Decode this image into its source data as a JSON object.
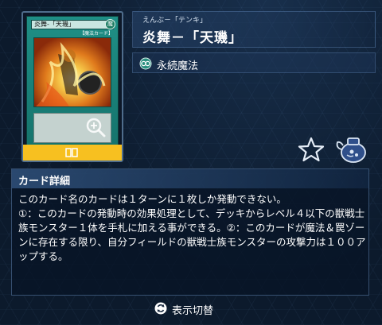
{
  "card": {
    "image_name": "炎舞-「天璣」",
    "image_type_line": "【魔法カード】",
    "attribute_glyph": "魔",
    "zoom_icon": "magnify-plus-icon",
    "tab_icon": "cards-icon"
  },
  "header": {
    "ruby": "えんぶ－「テンキ」",
    "name": "炎舞－「天璣」"
  },
  "type": {
    "icon": "continuous-spell-icon",
    "label": "永続魔法"
  },
  "actions": {
    "favorite_icon": "star-icon",
    "deck_icon": "deck-pot-icon"
  },
  "detail": {
    "title": "カード詳細",
    "text": "このカード名のカードは１ターンに１枚しか発動できない。\n①：このカードの発動時の効果処理として、デッキからレベル４以下の獣戦士族モンスター１体を手札に加える事ができる。②：このカードが魔法＆罠ゾーンに存在する限り、自分フィールドの獣戦士族モンスターの攻撃力は１００アップする。"
  },
  "footer": {
    "switch_icon": "swap-cycle-icon",
    "switch_label": "表示切替"
  },
  "colors": {
    "card_green": "#1f8f86",
    "tab_yellow": "#f7c020",
    "background": "#0c1a2c"
  }
}
